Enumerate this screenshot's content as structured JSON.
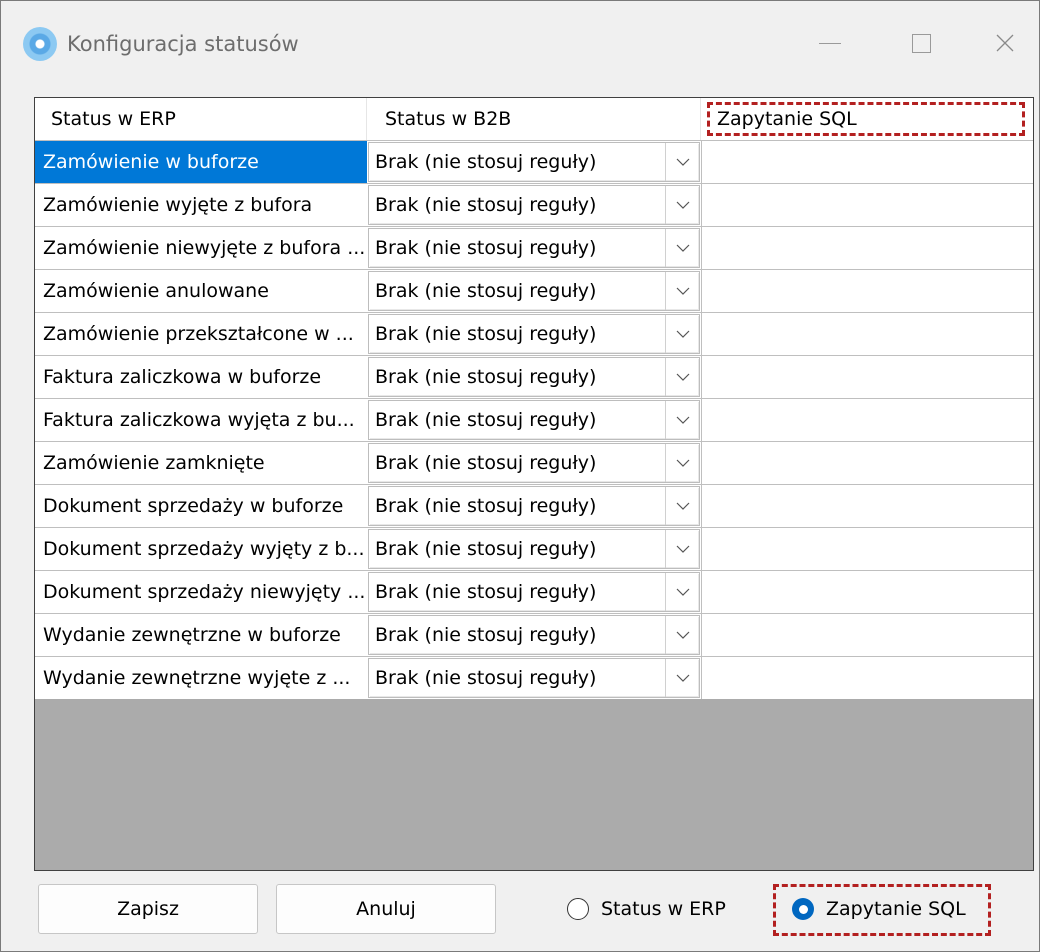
{
  "window": {
    "title": "Konfiguracja statusów",
    "icon": "app-gear-icon"
  },
  "grid": {
    "columns": [
      "Status w ERP",
      "Status w B2B",
      "Zapytanie SQL"
    ],
    "rows": [
      {
        "erp": "Zamówienie w buforze",
        "b2b": "Brak (nie stosuj reguły)",
        "sql": "",
        "selected": true
      },
      {
        "erp": "Zamówienie wyjęte z bufora",
        "b2b": "Brak (nie stosuj reguły)",
        "sql": ""
      },
      {
        "erp": "Zamówienie niewyjęte z bufora ...",
        "b2b": "Brak (nie stosuj reguły)",
        "sql": ""
      },
      {
        "erp": "Zamówienie anulowane",
        "b2b": "Brak (nie stosuj reguły)",
        "sql": ""
      },
      {
        "erp": "Zamówienie przekształcone w ...",
        "b2b": "Brak (nie stosuj reguły)",
        "sql": ""
      },
      {
        "erp": "Faktura zaliczkowa w buforze",
        "b2b": "Brak (nie stosuj reguły)",
        "sql": ""
      },
      {
        "erp": "Faktura zaliczkowa wyjęta z bu...",
        "b2b": "Brak (nie stosuj reguły)",
        "sql": ""
      },
      {
        "erp": "Zamówienie zamknięte",
        "b2b": "Brak (nie stosuj reguły)",
        "sql": ""
      },
      {
        "erp": "Dokument sprzedaży w buforze",
        "b2b": "Brak (nie stosuj reguły)",
        "sql": ""
      },
      {
        "erp": "Dokument sprzedaży wyjęty z b...",
        "b2b": "Brak (nie stosuj reguły)",
        "sql": ""
      },
      {
        "erp": "Dokument sprzedaży niewyjęty ...",
        "b2b": "Brak (nie stosuj reguły)",
        "sql": ""
      },
      {
        "erp": "Wydanie zewnętrzne w buforze",
        "b2b": "Brak (nie stosuj reguły)",
        "sql": ""
      },
      {
        "erp": "Wydanie zewnętrzne wyjęte z ...",
        "b2b": "Brak (nie stosuj reguły)",
        "sql": ""
      }
    ]
  },
  "buttons": {
    "save": "Zapisz",
    "cancel": "Anuluj"
  },
  "mode": {
    "options": [
      {
        "label": "Status w ERP",
        "checked": false
      },
      {
        "label": "Zapytanie SQL",
        "checked": true
      }
    ]
  },
  "colors": {
    "selection": "#0078d7",
    "highlight_dash": "#b32020",
    "radio_checked": "#0067c0",
    "grid_background": "#ababab"
  }
}
